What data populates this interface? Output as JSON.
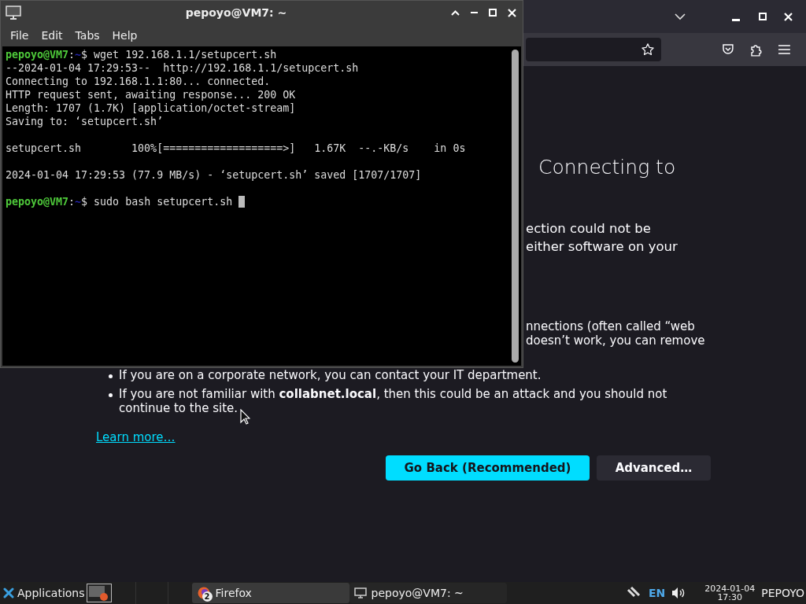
{
  "firefox": {
    "heading": "Connecting to",
    "paragraph_lines": [
      "ection could not be",
      "either software on your"
    ],
    "paragraph2_lines": [
      "nnections (often called “web",
      "doesn’t work, you can remove"
    ],
    "bullets": [
      "If you are on a corporate network, you can contact your IT department.",
      "If you are not familiar with **collabnet.local**, then this could be an attack and you should not continue to the site."
    ],
    "learn_more": "Learn more…",
    "buttons": [
      {
        "label": "Go Back (Recommended)",
        "kind": "primary"
      },
      {
        "label": "Advanced…",
        "kind": "secondary"
      }
    ]
  },
  "terminal": {
    "title": "pepoyo@VM7: ~",
    "menu": [
      "File",
      "Edit",
      "Tabs",
      "Help"
    ],
    "lines": [
      {
        "kind": "prompt",
        "user": "pepoyo@VM7",
        "sep": ":",
        "path": "~",
        "command": "$ wget 192.168.1.1/setupcert.sh",
        "cursor": false
      },
      {
        "kind": "output",
        "text": "--2024-01-04 17:29:53--  http://192.168.1.1/setupcert.sh"
      },
      {
        "kind": "output",
        "text": "Connecting to 192.168.1.1:80... connected."
      },
      {
        "kind": "output",
        "text": "HTTP request sent, awaiting response... 200 OK"
      },
      {
        "kind": "output",
        "text": "Length: 1707 (1.7K) [application/octet-stream]"
      },
      {
        "kind": "output",
        "text": "Saving to: ‘setupcert.sh’"
      },
      {
        "kind": "blank"
      },
      {
        "kind": "output",
        "text": "setupcert.sh        100%[===================>]   1.67K  --.-KB/s    in 0s"
      },
      {
        "kind": "blank"
      },
      {
        "kind": "output",
        "text": "2024-01-04 17:29:53 (77.9 MB/s) - ‘setupcert.sh’ saved [1707/1707]"
      },
      {
        "kind": "blank"
      },
      {
        "kind": "prompt",
        "user": "pepoyo@VM7",
        "sep": ":",
        "path": "~",
        "command": "$ sudo bash setupcert.sh",
        "cursor": true
      }
    ]
  },
  "taskbar": {
    "applications": "Applications",
    "tasks": [
      {
        "label": "Firefox",
        "badge": "2",
        "kind": "browser",
        "selected": true
      },
      {
        "label": "pepoyo@VM7: ~",
        "kind": "terminal",
        "selected": false
      }
    ],
    "language": "EN",
    "date": "2024-01-04",
    "time": "17:30",
    "user": "PEPOYO"
  }
}
